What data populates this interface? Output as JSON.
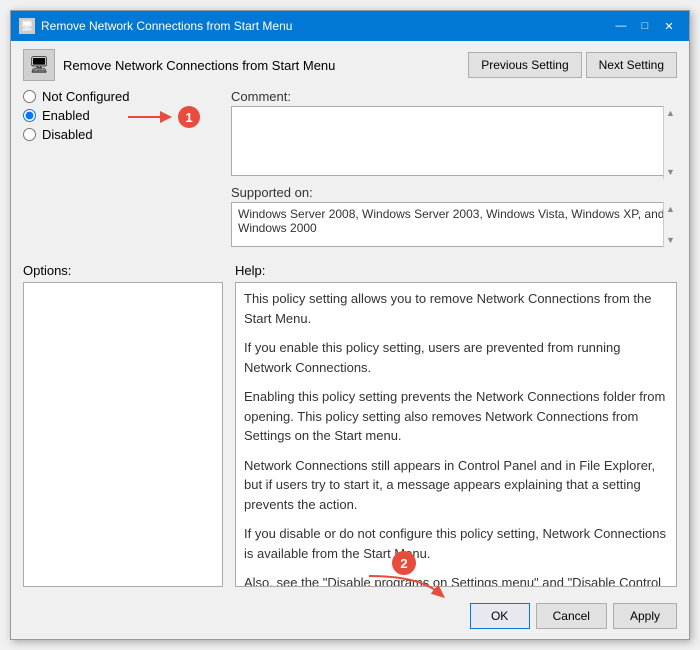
{
  "dialog": {
    "title": "Remove Network Connections from Start Menu",
    "header_title": "Remove Network Connections from Start Menu",
    "title_icon": "🖥"
  },
  "title_controls": {
    "minimize": "—",
    "maximize": "□",
    "close": "✕"
  },
  "nav_buttons": {
    "previous": "Previous Setting",
    "next": "Next Setting"
  },
  "radio": {
    "not_configured": "Not Configured",
    "enabled": "Enabled",
    "disabled": "Disabled"
  },
  "labels": {
    "comment": "Comment:",
    "supported_on": "Supported on:",
    "options": "Options:",
    "help": "Help:"
  },
  "supported_text": "Windows Server 2008, Windows Server 2003, Windows Vista, Windows XP, and Windows 2000",
  "help_paragraphs": [
    "This policy setting allows you to remove Network Connections from the Start Menu.",
    "If you enable this policy setting, users are prevented from running Network Connections.",
    "Enabling this policy setting prevents the Network Connections folder from opening. This policy setting also removes Network Connections from Settings on the Start menu.",
    "Network Connections still appears in Control Panel and in File Explorer, but if users try to start it, a message appears explaining that a setting prevents the action.",
    "If you disable or do not configure this policy setting, Network Connections is available from the Start Menu.",
    "Also, see the \"Disable programs on Settings menu\" and \"Disable Control Panel\" policy settings and the policy settings in the Network Connections folder (Computer Configuration and User Configuration\\Administrative Templates\\Network\\Network"
  ],
  "footer": {
    "ok": "OK",
    "cancel": "Cancel",
    "apply": "Apply"
  },
  "annotations": {
    "circle1": "1",
    "circle2": "2"
  }
}
